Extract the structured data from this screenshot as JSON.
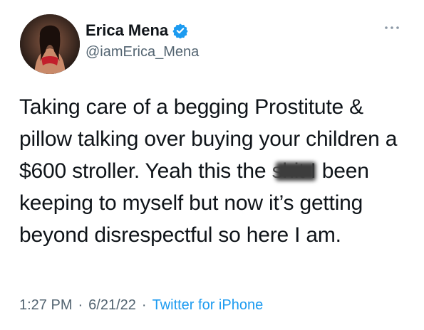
{
  "tweet": {
    "name": "Erica Mena",
    "handle": "@iamErica_Mena",
    "text": {
      "before": "Taking care of a begging Prostitute & pillow talking over buying your children a $600 stroller. Yeah this the ",
      "blurred_word": "shit",
      "after": " I been keeping to myself but now it’s getting beyond disrespectful so here I am."
    },
    "time": "1:27 PM",
    "date": "6/21/22",
    "separator": "·",
    "source": "Twitter for iPhone"
  },
  "icons": {
    "verified": "verified-badge-icon",
    "more": "more-options-icon"
  },
  "colors": {
    "text_primary": "#0f1419",
    "text_secondary": "#536471",
    "accent": "#1d9bf0"
  }
}
